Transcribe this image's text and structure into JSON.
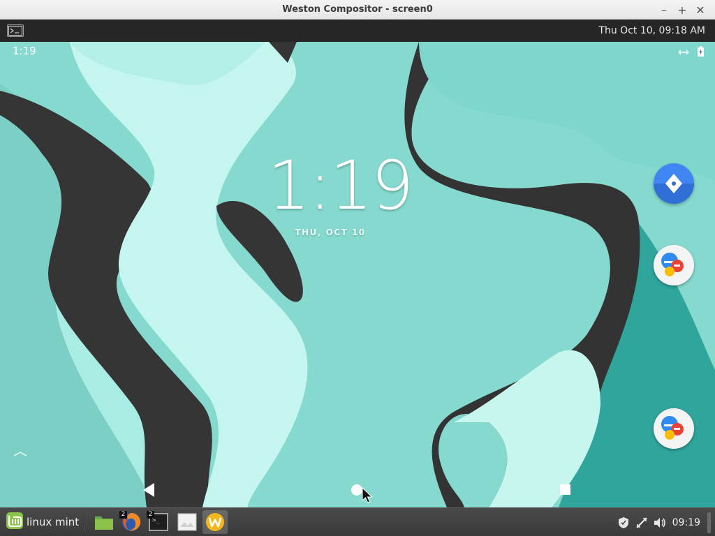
{
  "host_window": {
    "title": "Weston Compositor - screen0",
    "controls": {
      "minimize": "–",
      "maximize": "+",
      "close": "✕"
    }
  },
  "weston_panel": {
    "launcher_icon": "terminal-launcher-icon",
    "clock": "Thu Oct 10, 09:18 AM"
  },
  "android": {
    "status_bar": {
      "time": "1:19",
      "icons": [
        "data-transfer-icon",
        "battery-icon"
      ]
    },
    "lockscreen": {
      "clock": "1:19",
      "date": "THU, OCT 10"
    },
    "side_shortcuts": [
      "navigation-app-icon",
      "messaging-app-icon",
      "messaging-app-icon"
    ],
    "nav_bar": [
      "back-button",
      "home-button",
      "recents-button"
    ],
    "colors": {
      "wallpaper_teal": "#7fd6cb",
      "wallpaper_light": "#b9f2ea",
      "wallpaper_dark": "#333333",
      "wallpaper_deep": "#2fa59c"
    }
  },
  "taskbar": {
    "menu_label": "linux mint",
    "apps": [
      {
        "name": "file-manager",
        "badge": ""
      },
      {
        "name": "firefox",
        "badge": "2"
      },
      {
        "name": "terminal",
        "badge": "2"
      },
      {
        "name": "image-viewer",
        "badge": ""
      },
      {
        "name": "weston",
        "badge": ""
      }
    ],
    "tray_icons": [
      "shield-icon",
      "network-icon",
      "volume-icon"
    ],
    "clock": "09:19"
  }
}
